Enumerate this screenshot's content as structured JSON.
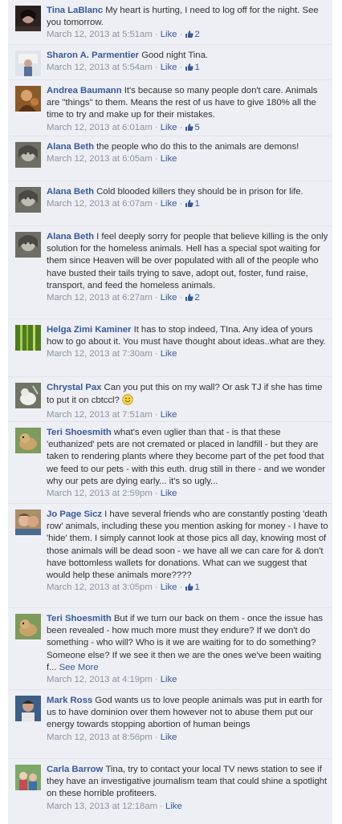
{
  "theme": {
    "thread_bg": "#edeff4",
    "author_color": "#3b5998",
    "meta_color": "#8d939f",
    "text_color": "#333333"
  },
  "icons": {
    "like_count": "thumbs-up-icon",
    "emoticon": "smiley-icon"
  },
  "separator": " · ",
  "comments": [
    {
      "author": "Tina LaBlanc",
      "text": "My heart is hurting, I need to log off for the night. See you tomorrow.",
      "timestamp": "March 12, 2013 at 5:51am",
      "like_label": "Like",
      "likes": "2"
    },
    {
      "author": "Sharon A. Parmentier",
      "text": "Good night Tina.",
      "timestamp": "March 12, 2013 at 5:54am",
      "like_label": "Like",
      "likes": "1"
    },
    {
      "author": "Andrea Baumann",
      "text": "It's because so many people don't care. Animals are \"things\" to them. Means the rest of us have to give 180% all the time to try and make up for their mistakes.",
      "timestamp": "March 12, 2013 at 6:01am",
      "like_label": "Like",
      "likes": "5"
    },
    {
      "author": "Alana Beth",
      "text": "the people who do this to the animals are demons!",
      "timestamp": "March 12, 2013 at 6:05am",
      "like_label": "Like"
    },
    {
      "author": "Alana Beth",
      "text": "Cold blooded killers they should be in prison for life.",
      "timestamp": "March 12, 2013 at 6:07am",
      "like_label": "Like",
      "likes": "1"
    },
    {
      "author": "Alana Beth",
      "text": "I feel deeply sorry for people that believe killing is the only solution for the homeless animals. Hell has a special spot waiting for them since Heaven will be over populated with all of the people who have busted their tails trying to save, adopt out, foster, fund raise, transport, and feed the homeless animals.",
      "timestamp": "March 12, 2013 at 6:27am",
      "like_label": "Like",
      "likes": "2"
    },
    {
      "author": "Helga Zimi Kaminer",
      "text": "It has to stop indeed, TIna. Any idea of yours how to go about it. You must have thought about ideas..what are they.",
      "timestamp": "March 12, 2013 at 7:30am",
      "like_label": "Like"
    },
    {
      "author": "Chrystal Pax",
      "text": "Can you put this on my wall? Or ask TJ if she has time to put it on cbtccl?",
      "timestamp": "March 12, 2013 at 7:51am",
      "like_label": "Like",
      "emoticon": true
    },
    {
      "author": "Teri Shoesmith",
      "text": "what's even uglier than that - is that these 'euthanized' pets are not cremated or placed in landfill - but they are taken to rendering plants where they become part of the pet food that we feed to our pets - with this euth. drug still in there - and we wonder why our pets are dying early... it's so ugly...",
      "timestamp": "March 12, 2013 at 2:59pm",
      "like_label": "Like"
    },
    {
      "author": "Jo Page Sicz",
      "text": "I have several friends who are constantly posting 'death row' animals, including these you mention asking for money - I have to 'hide' them. I simply cannot look at those pics all day, knowing most of those animals will be dead soon - we have all we can care for & don't have bottomless wallets for donations. What can we suggest that would help these animals more????",
      "timestamp": "March 12, 2013 at 3:05pm",
      "like_label": "Like",
      "likes": "1"
    },
    {
      "author": "Teri Shoesmith",
      "text": "But if we turn our back on them - once the issue has been revealed - how much more must they endure? If we don't do something - who will? Who is it we are waiting for to do something? Someone else? If we see it then we are the ones we've been waiting f...",
      "see_more": "See More",
      "timestamp": "March 12, 2013 at 4:19pm",
      "like_label": "Like"
    },
    {
      "author": "Mark Ross",
      "text": "God wants us to love people animals was put in earth for us to have dominion over them however not to abuse them put our energy towards stopping abortion of human beings",
      "timestamp": "March 12, 2013 at 8:56pm",
      "like_label": "Like"
    },
    {
      "author": "Carla Barrow",
      "text": "Tina, try to contact your local TV news station to see if they have an investigative journalism team that could shine a spotlight on these horrible profiteers.",
      "timestamp": "March 13, 2013 at 12:18am",
      "like_label": "Like"
    }
  ]
}
